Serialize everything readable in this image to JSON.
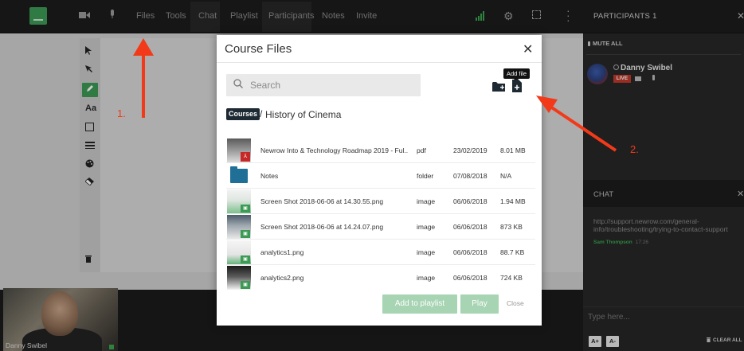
{
  "topbar": {
    "menus": [
      "Files",
      "Tools",
      "Chat",
      "Playlist",
      "Participants",
      "Notes",
      "Invite"
    ],
    "participants_title": "PARTICIPANTS 1"
  },
  "participants": {
    "mute_all": "MUTE ALL",
    "items": [
      {
        "name": "Danny Swibel",
        "badge": "LIVE"
      }
    ]
  },
  "chat": {
    "title": "CHAT",
    "message": "http://support.newrow.com/general-info/troubleshooting/trying-to-contact-support",
    "author": "Sam Thompson",
    "time": "17:26",
    "input_placeholder": "Type here...",
    "font_up": "A+",
    "font_down": "A-",
    "clear_all": "CLEAR ALL"
  },
  "video": {
    "name": "Danny Swibel"
  },
  "modal": {
    "title": "Course Files",
    "search_placeholder": "Search",
    "tooltip": "Add file",
    "breadcrumb_root": "Courses",
    "breadcrumb_separator": "/",
    "breadcrumb_current": "History of Cinema",
    "files": [
      {
        "name": "Newrow Into & Technology Roadmap 2019 - Ful...",
        "type": "pdf",
        "date": "23/02/2019",
        "size": "8.01 MB",
        "thumb": "pdf"
      },
      {
        "name": "Notes",
        "type": "folder",
        "date": "07/08/2018",
        "size": "N/A",
        "thumb": "folder"
      },
      {
        "name": "Screen Shot 2018-06-06 at 14.30.55.png",
        "type": "image",
        "date": "06/06/2018",
        "size": "1.94 MB",
        "thumb": "img"
      },
      {
        "name": "Screen Shot 2018-06-06 at 14.24.07.png",
        "type": "image",
        "date": "06/06/2018",
        "size": "873 KB",
        "thumb": "img2"
      },
      {
        "name": "analytics1.png",
        "type": "image",
        "date": "06/06/2018",
        "size": "88.7 KB",
        "thumb": "img3"
      },
      {
        "name": "analytics2.png",
        "type": "image",
        "date": "06/06/2018",
        "size": "724 KB",
        "thumb": "img4"
      }
    ],
    "add_to_playlist": "Add to playlist",
    "play": "Play",
    "close": "Close"
  },
  "annotations": {
    "label_1": "1.",
    "label_2": "2.",
    "color": "#f23a1a"
  },
  "colors": {
    "accent": "#3d9a55",
    "button_disabled": "#a7d4b3",
    "live": "#c0392b"
  }
}
